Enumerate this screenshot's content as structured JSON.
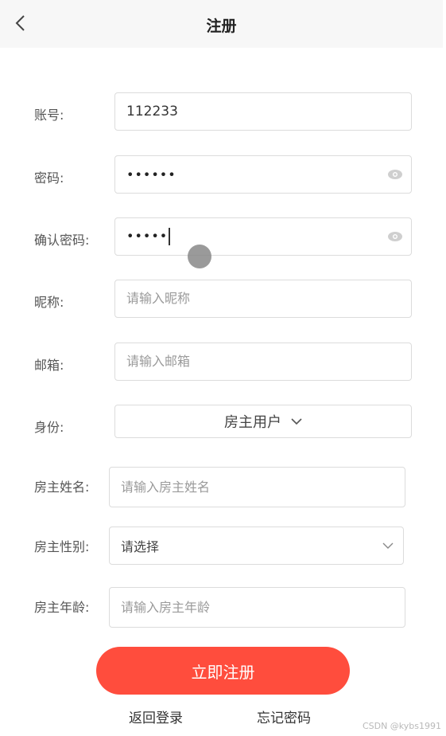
{
  "header": {
    "title": "注册",
    "back_icon": "chevron-left-icon"
  },
  "form": {
    "account": {
      "label": "账号:",
      "value": "112233"
    },
    "password": {
      "label": "密码:",
      "masked_value": "••••••",
      "icon": "eye-icon"
    },
    "confirm_password": {
      "label": "确认密码:",
      "masked_value": "•••••",
      "icon": "eye-icon"
    },
    "nickname": {
      "label": "昵称:",
      "placeholder": "请输入昵称"
    },
    "email": {
      "label": "邮箱:",
      "placeholder": "请输入邮箱"
    },
    "identity": {
      "label": "身份:",
      "selected": "房主用户",
      "icon": "chevron-down-icon"
    },
    "owner_name": {
      "label": "房主姓名:",
      "placeholder": "请输入房主姓名"
    },
    "owner_gender": {
      "label": "房主性别:",
      "selected": "请选择",
      "icon": "chevron-down-icon"
    },
    "owner_age": {
      "label": "房主年龄:",
      "placeholder": "请输入房主年龄"
    }
  },
  "actions": {
    "submit_label": "立即注册",
    "back_to_login": "返回登录",
    "forgot_password": "忘记密码"
  },
  "watermark": "CSDN @kybs1991",
  "colors": {
    "accent": "#ff4d3d",
    "header_bg": "#f7f7f7",
    "border": "#dcdcdc"
  }
}
